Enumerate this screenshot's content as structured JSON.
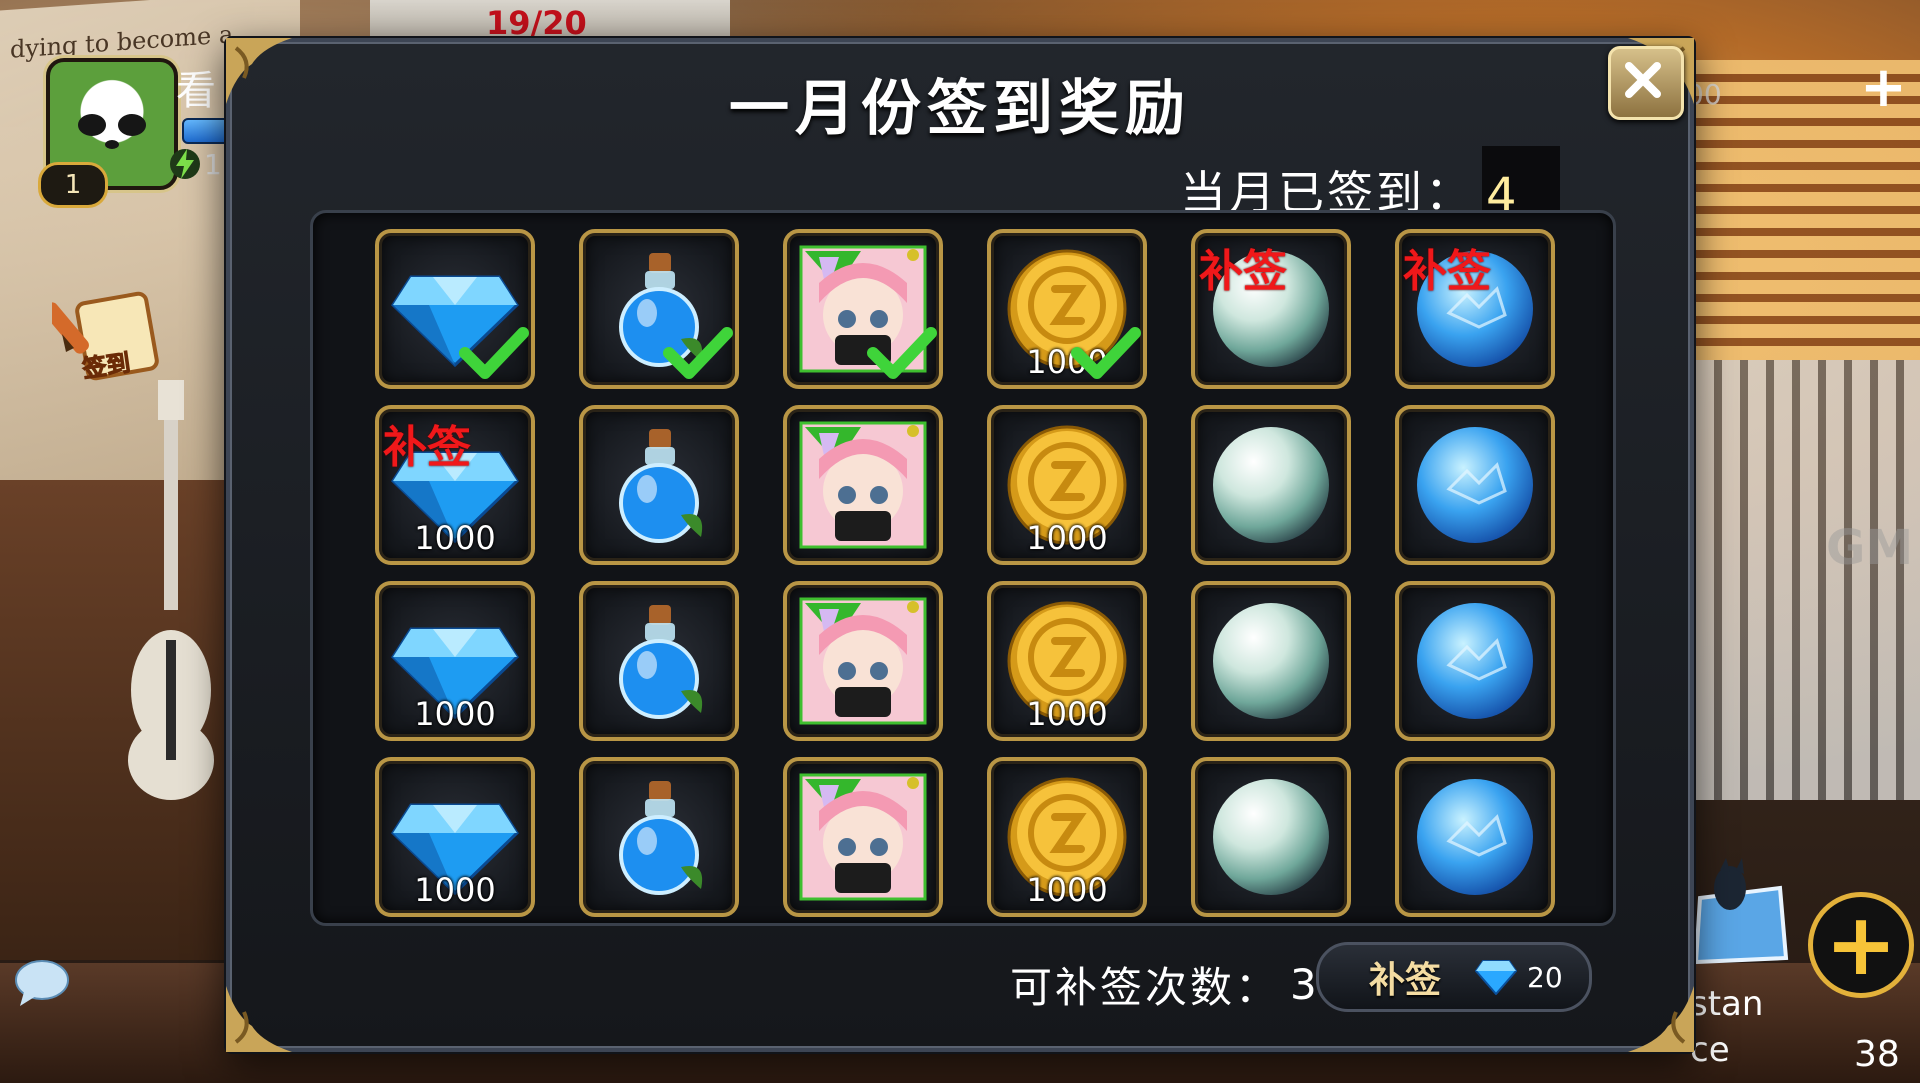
{
  "background": {
    "poster_text": "dying to become a",
    "top_counter": "19/20"
  },
  "hud": {
    "player_name": "看",
    "level": "1",
    "energy_partial": "1",
    "signin_label": "签到",
    "right_value": "00",
    "gm_label": "GM",
    "side_text_1": "stan",
    "side_text_2": "ce",
    "side_number": "38"
  },
  "dialog": {
    "title": "一月份签到奖励",
    "signed_label": "当月已签到：",
    "signed_count": "4",
    "makeup_label": "可补签次数：",
    "makeup_count": "3",
    "makeup_button_label": "补签",
    "makeup_cost": "20",
    "makeup_tag": "补签"
  },
  "rewards": [
    [
      {
        "item": "diamond",
        "qty": "",
        "signed": true,
        "tag": ""
      },
      {
        "item": "potion",
        "qty": "",
        "signed": true,
        "tag": ""
      },
      {
        "item": "character",
        "qty": "",
        "signed": true,
        "tag": ""
      },
      {
        "item": "coin",
        "qty": "1000",
        "signed": true,
        "tag": ""
      },
      {
        "item": "pearl",
        "qty": "",
        "signed": false,
        "tag": "补签"
      },
      {
        "item": "blue-orb",
        "qty": "",
        "signed": false,
        "tag": "补签"
      }
    ],
    [
      {
        "item": "diamond",
        "qty": "1000",
        "signed": false,
        "tag": "补签"
      },
      {
        "item": "potion",
        "qty": "",
        "signed": false,
        "tag": ""
      },
      {
        "item": "character",
        "qty": "",
        "signed": false,
        "tag": ""
      },
      {
        "item": "coin",
        "qty": "1000",
        "signed": false,
        "tag": ""
      },
      {
        "item": "pearl",
        "qty": "",
        "signed": false,
        "tag": ""
      },
      {
        "item": "blue-orb",
        "qty": "",
        "signed": false,
        "tag": ""
      }
    ],
    [
      {
        "item": "diamond",
        "qty": "1000",
        "signed": false,
        "tag": ""
      },
      {
        "item": "potion",
        "qty": "",
        "signed": false,
        "tag": ""
      },
      {
        "item": "character",
        "qty": "",
        "signed": false,
        "tag": ""
      },
      {
        "item": "coin",
        "qty": "1000",
        "signed": false,
        "tag": ""
      },
      {
        "item": "pearl",
        "qty": "",
        "signed": false,
        "tag": ""
      },
      {
        "item": "blue-orb",
        "qty": "",
        "signed": false,
        "tag": ""
      }
    ],
    [
      {
        "item": "diamond",
        "qty": "1000",
        "signed": false,
        "tag": ""
      },
      {
        "item": "potion",
        "qty": "",
        "signed": false,
        "tag": ""
      },
      {
        "item": "character",
        "qty": "",
        "signed": false,
        "tag": ""
      },
      {
        "item": "coin",
        "qty": "1000",
        "signed": false,
        "tag": ""
      },
      {
        "item": "pearl",
        "qty": "",
        "signed": false,
        "tag": ""
      },
      {
        "item": "blue-orb",
        "qty": "",
        "signed": false,
        "tag": ""
      }
    ]
  ],
  "colors": {
    "frame_gold": "#b99645",
    "check_green": "#3fd43a",
    "tag_red": "#f0181a",
    "accent_yellow": "#ffec9e"
  }
}
